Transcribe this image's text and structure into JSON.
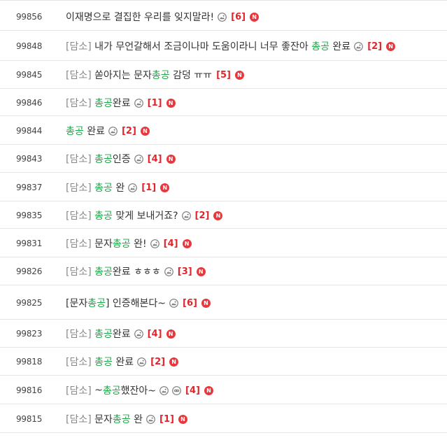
{
  "colors": {
    "accent_green": "#1aa846",
    "comment_red": "#e0262c",
    "new_badge_red": "#e8383d",
    "prefix_gray": "#888888",
    "row_border": "#e5e5e5"
  },
  "rows": [
    {
      "num": "99856",
      "segs": [
        {
          "t": "이재명으로 결집한 우리를 잊지말라!",
          "c": "n"
        }
      ],
      "icons": [
        "image"
      ],
      "comments": "[6]",
      "new": "N"
    },
    {
      "num": "99848",
      "segs": [
        {
          "t": "[담소] ",
          "c": "g"
        },
        {
          "t": "내가 무언갈해서 조금이나마 도움이라니 너무 좋잔아 ",
          "c": "n"
        },
        {
          "t": "총공",
          "c": "h"
        },
        {
          "t": " 완료",
          "c": "n"
        }
      ],
      "icons": [
        "image"
      ],
      "comments": "[2]",
      "new": "N"
    },
    {
      "num": "99845",
      "segs": [
        {
          "t": "[담소] ",
          "c": "g"
        },
        {
          "t": "쏟아지는 문자",
          "c": "n"
        },
        {
          "t": "총공",
          "c": "h"
        },
        {
          "t": " 감덩 ㅠㅠ",
          "c": "n"
        }
      ],
      "icons": [],
      "comments": "[5]",
      "new": "N"
    },
    {
      "num": "99846",
      "segs": [
        {
          "t": "[담소] ",
          "c": "g"
        },
        {
          "t": "총공",
          "c": "h"
        },
        {
          "t": "완료",
          "c": "n"
        }
      ],
      "icons": [
        "image"
      ],
      "comments": "[1]",
      "new": "N"
    },
    {
      "num": "99844",
      "segs": [
        {
          "t": "총공",
          "c": "h"
        },
        {
          "t": " 완료",
          "c": "n"
        }
      ],
      "icons": [
        "image"
      ],
      "comments": "[2]",
      "new": "N"
    },
    {
      "num": "99843",
      "segs": [
        {
          "t": "[담소] ",
          "c": "g"
        },
        {
          "t": "총공",
          "c": "h"
        },
        {
          "t": "인증",
          "c": "n"
        }
      ],
      "icons": [
        "image"
      ],
      "comments": "[4]",
      "new": "N"
    },
    {
      "num": "99837",
      "segs": [
        {
          "t": "[담소] ",
          "c": "g"
        },
        {
          "t": "총공",
          "c": "h"
        },
        {
          "t": " 완",
          "c": "n"
        }
      ],
      "icons": [
        "image"
      ],
      "comments": "[1]",
      "new": "N"
    },
    {
      "num": "99835",
      "segs": [
        {
          "t": "[담소] ",
          "c": "g"
        },
        {
          "t": "총공",
          "c": "h"
        },
        {
          "t": " 맞게 보내거죠?",
          "c": "n"
        }
      ],
      "icons": [
        "image"
      ],
      "comments": "[2]",
      "new": "N"
    },
    {
      "num": "99831",
      "segs": [
        {
          "t": "[담소] ",
          "c": "g"
        },
        {
          "t": "문자",
          "c": "n"
        },
        {
          "t": "총공",
          "c": "h"
        },
        {
          "t": " 완!",
          "c": "n"
        }
      ],
      "icons": [
        "image"
      ],
      "comments": "[4]",
      "new": "N"
    },
    {
      "num": "99826",
      "segs": [
        {
          "t": "[담소] ",
          "c": "g"
        },
        {
          "t": "총공",
          "c": "h"
        },
        {
          "t": "완료 ㅎㅎㅎ",
          "c": "n"
        }
      ],
      "icons": [
        "image"
      ],
      "comments": "[3]",
      "new": "N"
    },
    {
      "num": "99825",
      "segs": [
        {
          "t": "[문자",
          "c": "n"
        },
        {
          "t": "총공",
          "c": "h"
        },
        {
          "t": "] 인증해본다~",
          "c": "n"
        }
      ],
      "icons": [
        "image"
      ],
      "comments": "[6]",
      "new": "N"
    },
    {
      "num": "99823",
      "segs": [
        {
          "t": "[담소] ",
          "c": "g"
        },
        {
          "t": "총공",
          "c": "h"
        },
        {
          "t": "완료",
          "c": "n"
        }
      ],
      "icons": [
        "image"
      ],
      "comments": "[4]",
      "new": "N"
    },
    {
      "num": "99818",
      "segs": [
        {
          "t": "[담소] ",
          "c": "g"
        },
        {
          "t": "총공",
          "c": "h"
        },
        {
          "t": " 완료",
          "c": "n"
        }
      ],
      "icons": [
        "image"
      ],
      "comments": "[2]",
      "new": "N"
    },
    {
      "num": "99816",
      "segs": [
        {
          "t": "[담소] ",
          "c": "g"
        },
        {
          "t": "~",
          "c": "n"
        },
        {
          "t": "총공",
          "c": "h"
        },
        {
          "t": "했잔아~",
          "c": "n"
        }
      ],
      "icons": [
        "image",
        "link"
      ],
      "comments": "[4]",
      "new": "N"
    },
    {
      "num": "99815",
      "segs": [
        {
          "t": "[담소] ",
          "c": "g"
        },
        {
          "t": "문자",
          "c": "n"
        },
        {
          "t": "총공",
          "c": "h"
        },
        {
          "t": " 완",
          "c": "n"
        }
      ],
      "icons": [
        "image"
      ],
      "comments": "[1]",
      "new": "N"
    }
  ]
}
